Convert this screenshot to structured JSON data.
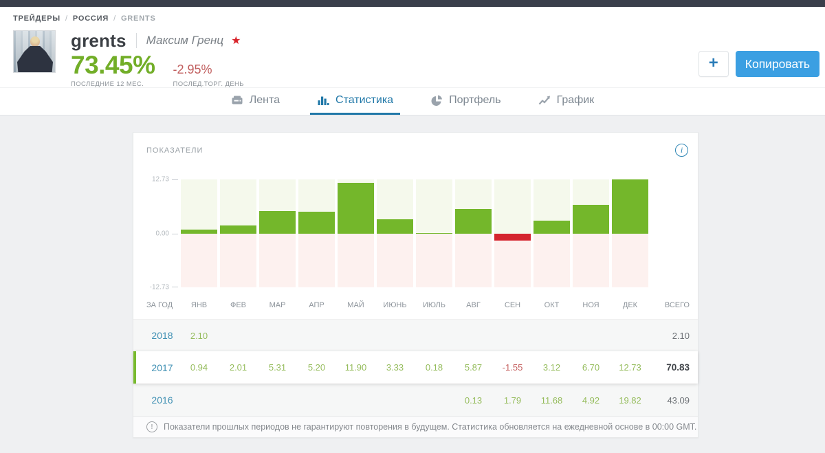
{
  "breadcrumb": {
    "items": [
      "ТРЕЙДЕРЫ",
      "РОССИЯ",
      "GRENTS"
    ]
  },
  "profile": {
    "username": "grents",
    "full_name": "Максим Гренц",
    "star_icon": "★",
    "gain_12m": "73.45%",
    "gain_12m_label": "ПОСЛЕДНИЕ 12 МЕС.",
    "daily_change": "-2.95%",
    "daily_change_label": "ПОСЛЕД.ТОРГ. ДЕНЬ"
  },
  "actions": {
    "add_label": "+",
    "copy_label": "Копировать"
  },
  "tabs": {
    "items": [
      {
        "label": "Лента",
        "active": false
      },
      {
        "label": "Статистика",
        "active": true
      },
      {
        "label": "Портфель",
        "active": false
      },
      {
        "label": "График",
        "active": false
      }
    ]
  },
  "panel": {
    "title": "ПОКАЗАТЕЛИ",
    "info_icon": "i"
  },
  "chart_data": {
    "type": "bar",
    "title": "ПОКАЗАТЕЛИ",
    "categories": [
      "ЯНВ",
      "ФЕВ",
      "МАР",
      "АПР",
      "МАЙ",
      "ИЮНЬ",
      "ИЮЛЬ",
      "АВГ",
      "СЕН",
      "ОКТ",
      "НОЯ",
      "ДЕК"
    ],
    "series": [
      {
        "name": "2017",
        "values": [
          0.94,
          2.01,
          5.31,
          5.2,
          11.9,
          3.33,
          0.18,
          5.87,
          -1.55,
          3.12,
          6.7,
          12.73
        ]
      }
    ],
    "ylim": [
      -12.73,
      12.73
    ],
    "yticks": [
      "12.73",
      "0.00",
      "-12.73"
    ],
    "grid": false,
    "legend": "none",
    "positive_color": "#74b72b",
    "negative_color": "#d4252e",
    "positive_bg": "#f5f9ec",
    "negative_bg": "#fdf1ef"
  },
  "table": {
    "header": [
      "ЗА ГОД",
      "ЯНВ",
      "ФЕВ",
      "МАР",
      "АПР",
      "МАЙ",
      "ИЮНЬ",
      "ИЮЛЬ",
      "АВГ",
      "СЕН",
      "ОКТ",
      "НОЯ",
      "ДЕК",
      "ВСЕГО"
    ],
    "rows": [
      {
        "year": "2018",
        "values": [
          "2.10",
          "",
          "",
          "",
          "",
          "",
          "",
          "",
          "",
          "",
          "",
          ""
        ],
        "total": "2.10",
        "highlight": false
      },
      {
        "year": "2017",
        "values": [
          "0.94",
          "2.01",
          "5.31",
          "5.20",
          "11.90",
          "3.33",
          "0.18",
          "5.87",
          "-1.55",
          "3.12",
          "6.70",
          "12.73"
        ],
        "total": "70.83",
        "highlight": true
      },
      {
        "year": "2016",
        "values": [
          "",
          "",
          "",
          "",
          "",
          "",
          "",
          "0.13",
          "1.79",
          "11.68",
          "4.92",
          "19.82"
        ],
        "total": "43.09",
        "highlight": false
      }
    ]
  },
  "footnote": {
    "icon": "!",
    "text": "Показатели прошлых периодов не гарантируют повторения в будущем. Статистика обновляется на ежедневной основе в 00:00 GMT."
  },
  "colors": {
    "topbar": "#3a3f4b",
    "page_bg": "#eff0f2",
    "accent_blue": "#2178a8",
    "copy_button_blue": "#3b9fe2",
    "gain_green": "#72ae28",
    "loss_red": "#c05c5c",
    "year_link_blue": "#4191b4",
    "star_red": "#d8232a"
  }
}
